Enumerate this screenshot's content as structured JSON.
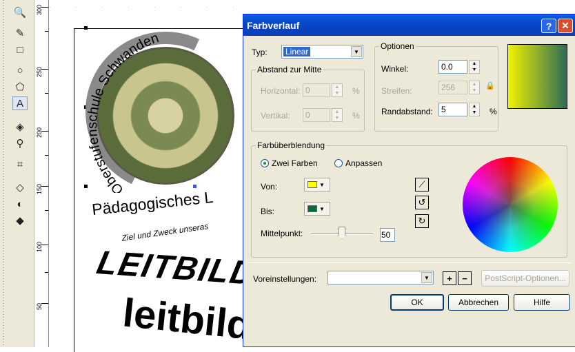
{
  "ruler": {
    "labels": [
      "300",
      "250",
      "200",
      "150",
      "100",
      "50"
    ]
  },
  "canvas": {
    "logo_arc_text": "Oberstufenschule Schwanden",
    "paed_text": "Pädagogisches L",
    "ziel_text": "Ziel und Zweck unseras",
    "leitbild_upper": "LEITBILD",
    "leitbild_lower": "leitbild"
  },
  "dialog": {
    "title": "Farbverlauf",
    "help_glyph": "?",
    "close_glyph": "✕",
    "typ_label": "Typ:",
    "typ_value": "Linear",
    "abstand_group": "Abstand zur Mitte",
    "horizontal_label": "Horizontal:",
    "horizontal_value": "0",
    "vertikal_label": "Vertikal:",
    "vertikal_value": "0",
    "percent": "%",
    "optionen_group": "Optionen",
    "winkel_label": "Winkel:",
    "winkel_value": "0.0",
    "streifen_label": "Streifen:",
    "streifen_value": "256",
    "rand_label": "Randabstand:",
    "rand_value": "5",
    "blend_group": "Farbüberblendung",
    "radio_two": "Zwei Farben",
    "radio_custom": "Anpassen",
    "von_label": "Von:",
    "bis_label": "Bis:",
    "von_color": "#ffff00",
    "bis_color": "#0a6b3a",
    "mittelpunkt_label": "Mittelpunkt:",
    "mittelpunkt_value": "50",
    "mittelpunkt_fraction": 0.5,
    "presets_label": "Voreinstellungen:",
    "presets_value": "",
    "plus": "+",
    "minus": "−",
    "postscript_button": "PostScript-Optionen...",
    "ok_button": "OK",
    "cancel_button": "Abbrechen",
    "help_button": "Hilfe",
    "gradient_start": "#f2f200",
    "gradient_end": "#2d6b58"
  }
}
